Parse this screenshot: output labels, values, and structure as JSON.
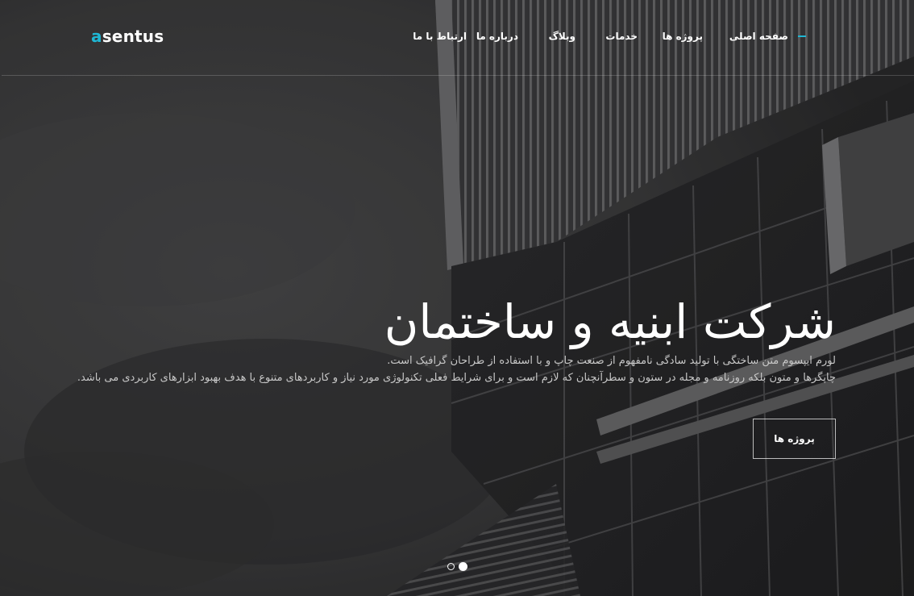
{
  "brand": {
    "logo_first": "a",
    "logo_rest": "sentus",
    "accent_color": "#1fb7d4"
  },
  "nav": {
    "items": [
      {
        "label": "صفحه اصلی",
        "active": true
      },
      {
        "label": "پروژه ها"
      },
      {
        "label": "خدمات"
      },
      {
        "label": "وبلاگ"
      },
      {
        "label": "درباره ما"
      },
      {
        "label": "ارتباط با ما"
      }
    ]
  },
  "hero": {
    "title": "شرکت ابنیه و ساختمان",
    "desc_line1": "لورم ایپسوم متن ساختگی با تولید سادگی نامفهوم از صنعت چاپ و با استفاده از طراحان گرافیک است.",
    "desc_line2": "چاپگرها و متون بلکه روزنامه و مجله در ستون و سطرآنچنان که لازم است و برای شرایط فعلی تکنولوژی مورد نیاز و کاربردهای متنوع با هدف بهبود ابزارهای کاربردی می باشد.",
    "cta_label": "پروژه ها"
  },
  "slider": {
    "slide_count": 2,
    "active_index": 1
  }
}
